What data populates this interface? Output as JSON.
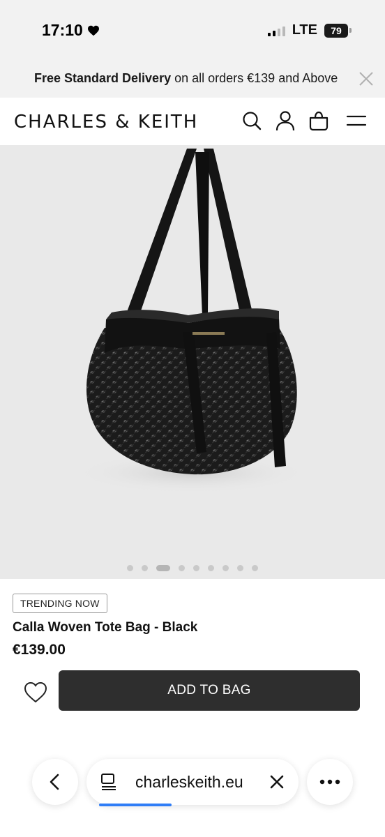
{
  "status_bar": {
    "time": "17:10",
    "network": "LTE",
    "battery": "79"
  },
  "promo": {
    "bold_text": "Free Standard Delivery",
    "rest_text": " on all orders €139 and Above"
  },
  "header": {
    "brand": "CHARLES & KEITH",
    "icons": [
      "search-icon",
      "account-icon",
      "bag-icon",
      "menu-icon"
    ]
  },
  "gallery": {
    "image_count": 9,
    "active_index": 2
  },
  "product": {
    "badge": "TRENDING NOW",
    "name": "Calla Woven Tote Bag - Black",
    "price": "€139.00",
    "add_to_bag_label": "ADD TO BAG"
  },
  "browser": {
    "url": "charleskeith.eu"
  },
  "colors": {
    "button_bg": "#2e2e2e",
    "banner_bg": "#f2f2f2",
    "gallery_bg": "#e9e9e9",
    "progress": "#2f7df6"
  }
}
